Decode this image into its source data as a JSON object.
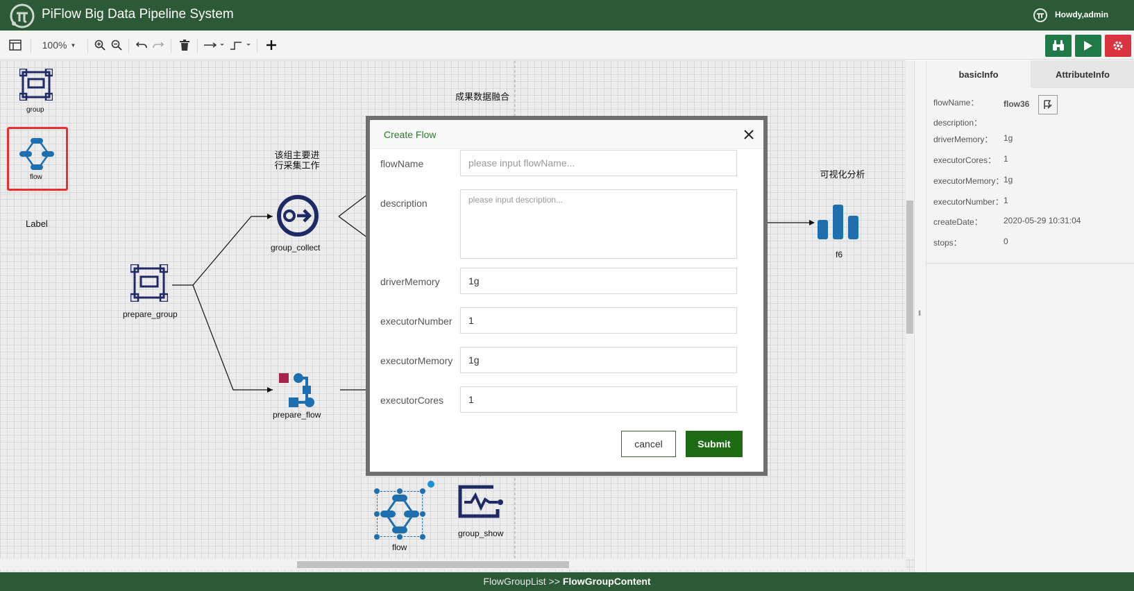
{
  "header": {
    "title": "PiFlow Big Data Pipeline System",
    "user": "Howdy,admin"
  },
  "toolbar": {
    "zoom": "100%",
    "icons": [
      "format-panel-icon",
      "zoom-in-icon",
      "zoom-out-icon",
      "undo-icon",
      "redo-icon",
      "delete-icon",
      "connection-style-icon",
      "waypoints-icon",
      "add-icon",
      "find-icon",
      "run-icon",
      "settings-icon"
    ],
    "accent_colors": {
      "find": "#1f7a48",
      "run": "#1f7a48",
      "settings": "#d9333f"
    }
  },
  "palette": {
    "items": [
      {
        "label": "group",
        "icon": "group-icon"
      },
      {
        "label": "flow",
        "icon": "flow-icon"
      }
    ],
    "label_item": "Label"
  },
  "canvas": {
    "notes": [
      "该组主要进\n行采集工作",
      "成果数据融合",
      "可视化分析"
    ],
    "nodes": [
      {
        "label": "group_collect",
        "icon": "group-collect-icon"
      },
      {
        "label": "prepare_group",
        "icon": "group-icon"
      },
      {
        "label": "prepare_flow",
        "icon": "prepare-flow-icon"
      },
      {
        "label": "f6",
        "icon": "bar-chart-icon"
      },
      {
        "label": "flow",
        "icon": "flow-icon"
      },
      {
        "label": "group_show",
        "icon": "group-show-icon"
      }
    ]
  },
  "panel": {
    "tabs": [
      "basicInfo",
      "AttributeInfo"
    ],
    "fields": [
      {
        "label": "flowName：",
        "value": "flow36"
      },
      {
        "label": "description：",
        "value": ""
      },
      {
        "label": "driverMemory：",
        "value": "1g"
      },
      {
        "label": "executorCores：",
        "value": "1"
      },
      {
        "label": "executorMemory：",
        "value": "1g"
      },
      {
        "label": "executorNumber：",
        "value": "1"
      },
      {
        "label": "createDate：",
        "value": "2020-05-29 10:31:04"
      },
      {
        "label": "stops：",
        "value": "0"
      }
    ]
  },
  "modal": {
    "title": "Create Flow",
    "fields": {
      "flowName": {
        "label": "flowName",
        "value": "",
        "placeholder": "please input flowName..."
      },
      "description": {
        "label": "description",
        "value": "",
        "placeholder": "please input description..."
      },
      "driverMemory": {
        "label": "driverMemory",
        "value": "1g"
      },
      "executorNumber": {
        "label": "executorNumber",
        "value": "1"
      },
      "executorMemory": {
        "label": "executorMemory",
        "value": "1g"
      },
      "executorCores": {
        "label": "executorCores",
        "value": "1"
      }
    },
    "cancel_label": "cancel",
    "submit_label": "Submit"
  },
  "footer": {
    "crumb_parent": "FlowGroupList",
    "crumb_sep": " >> ",
    "crumb_current": "FlowGroupContent"
  }
}
